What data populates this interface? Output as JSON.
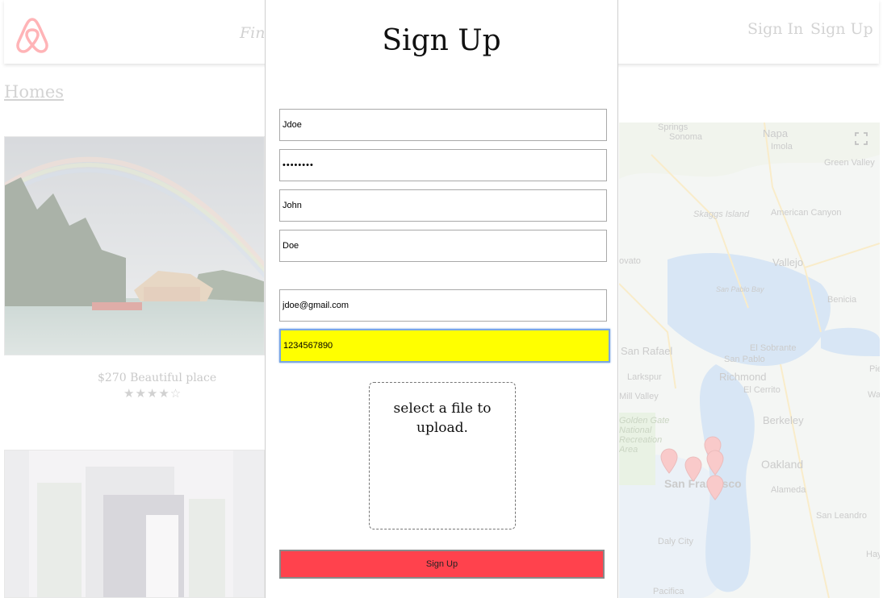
{
  "header": {
    "find_text": "Find",
    "sign_in": "Sign In",
    "sign_up": "Sign Up"
  },
  "homes_link": "Homes",
  "listings": [
    {
      "caption": "$270 Beautiful place",
      "rating_stars": "★★★★☆",
      "rating": 4
    }
  ],
  "map": {
    "labels": [
      "Springs",
      "Sonoma",
      "Napa",
      "Imola",
      "Green Valley",
      "Skaggs Island",
      "American Canyon",
      "Vallejo",
      "San Pablo Bay",
      "Benicia",
      "San Rafael",
      "El Sobrante",
      "San Pablo",
      "Larkspur",
      "Richmond",
      "El Cerrito",
      "Mill Valley",
      "Golden Gate National Recreation Area",
      "Berkeley",
      "Oakland",
      "San Francisco",
      "Alameda",
      "San Leandro",
      "Daly City",
      "Pacifica",
      "ovato",
      "Pie",
      "Wal",
      "Hay"
    ],
    "fullscreen_icon": "fullscreen-icon",
    "pin_color": "#f28b8b"
  },
  "modal": {
    "title": "Sign Up",
    "fields": {
      "username": "Jdoe",
      "password": "••••••••",
      "first_name": "John",
      "last_name": "Doe",
      "email": "jdoe@gmail.com",
      "phone": "1234567890"
    },
    "dropzone_text": "select a file to upload.",
    "submit_label": "Sign Up"
  },
  "colors": {
    "brand": "#ff5a5f",
    "submit_bg": "#ff424d",
    "focused_field_bg": "#ffff00",
    "focus_ring": "#79a6e2"
  }
}
